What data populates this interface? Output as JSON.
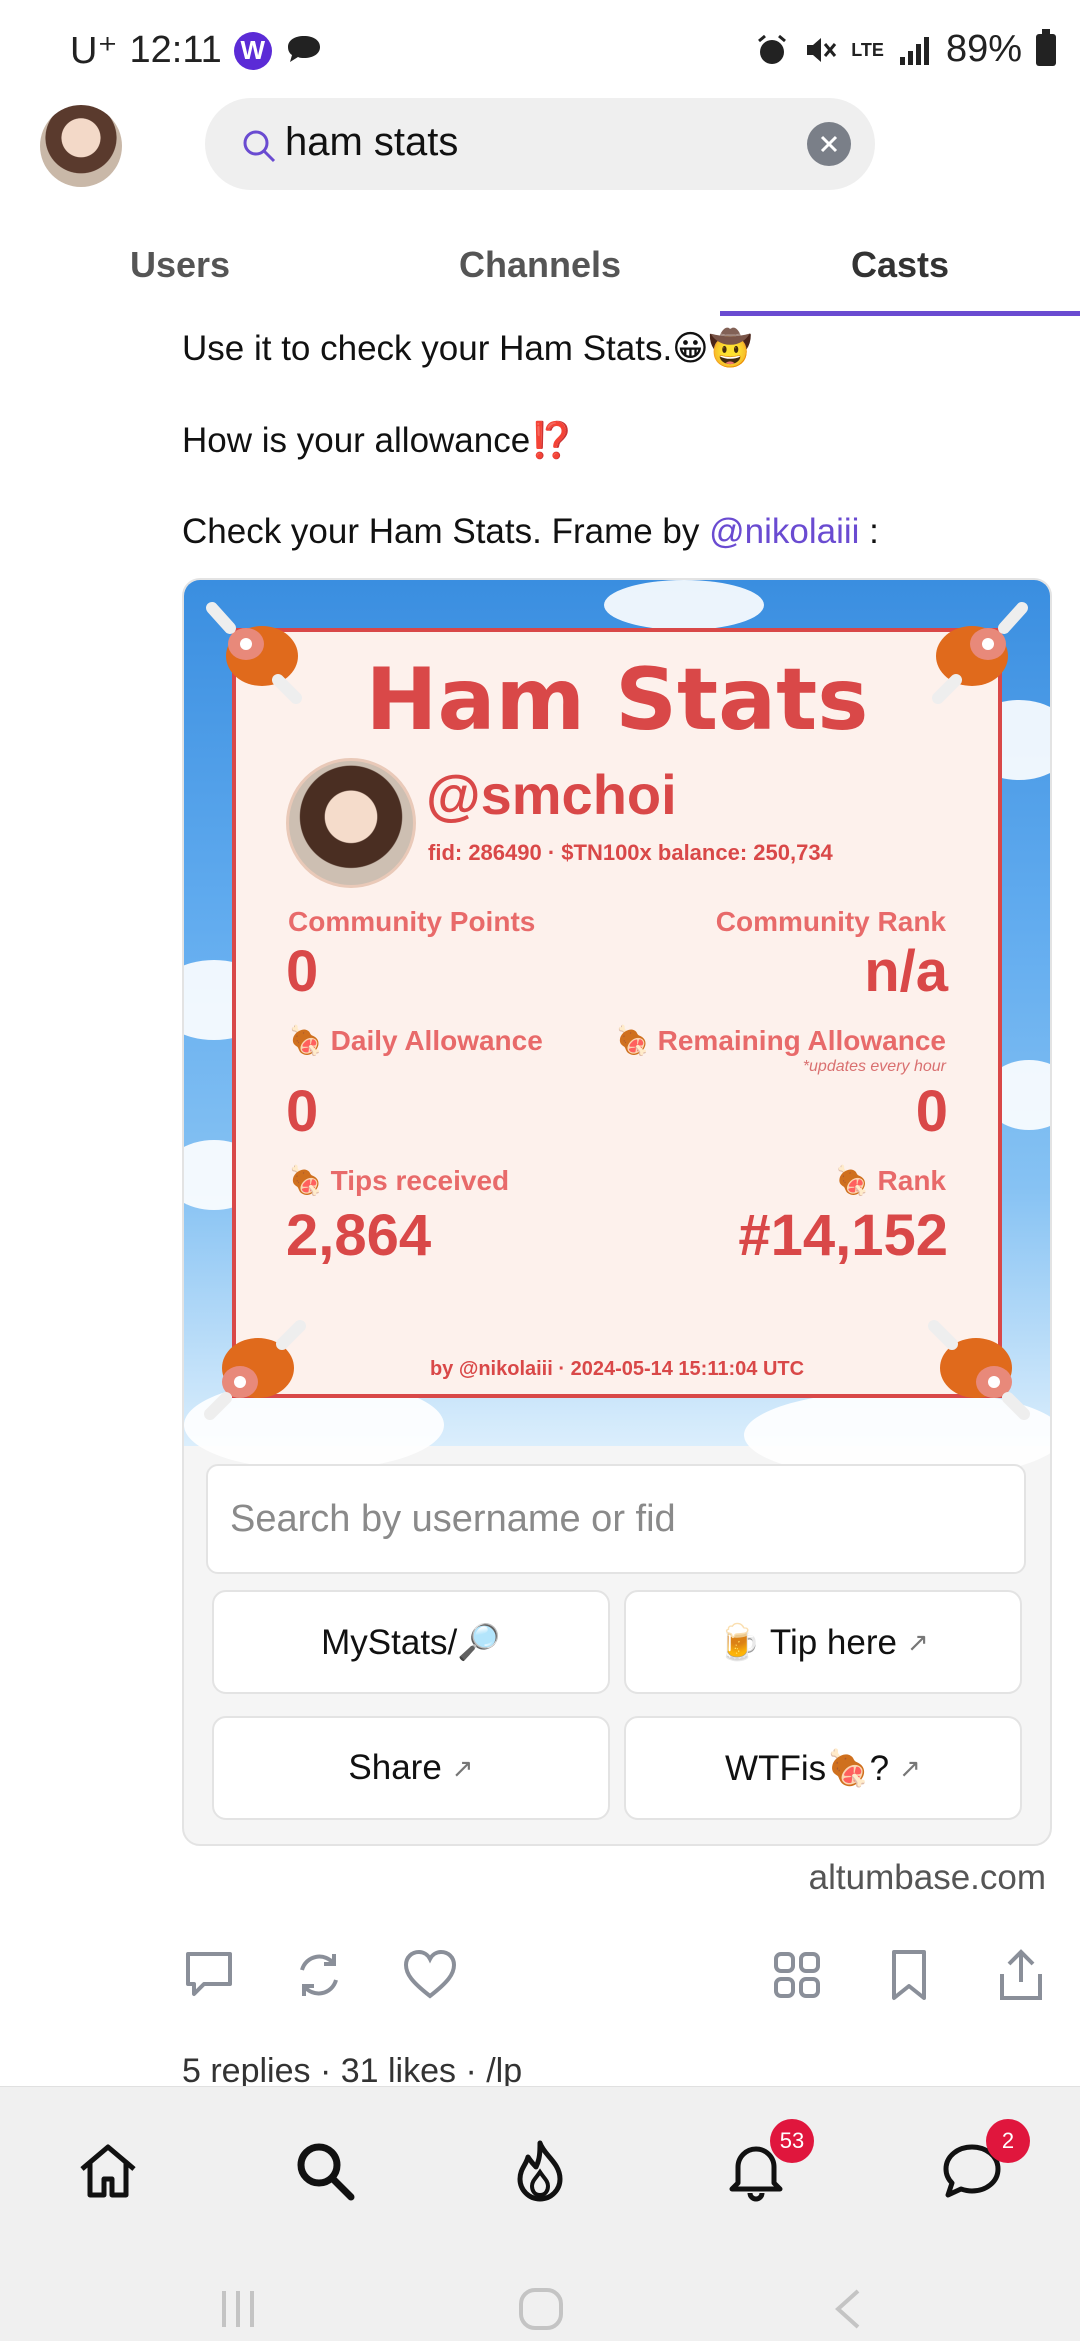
{
  "status_bar": {
    "carrier": "U⁺",
    "time": "12:11",
    "battery": "89%",
    "network": "LTE"
  },
  "search": {
    "query": "ham stats"
  },
  "tabs": [
    {
      "label": "Users"
    },
    {
      "label": "Channels"
    },
    {
      "label": "Casts"
    }
  ],
  "active_tab": "Casts",
  "cast": {
    "line1": "Use it to check your Ham Stats.😀🤠",
    "line2": "How is your allowance⁉️",
    "line3_prefix": "Check your Ham Stats. Frame by ",
    "line3_mention": "@nikolaiii",
    "line3_suffix": " :"
  },
  "frame": {
    "title": "Ham Stats",
    "handle": "@smchoi",
    "fid_line": "fid: 286490 · $TN100x balance: 250,734",
    "community_points_label": "Community Points",
    "community_points_value": "0",
    "community_rank_label": "Community Rank",
    "community_rank_value": "n/a",
    "daily_allowance_label": "Daily Allowance",
    "daily_allowance_value": "0",
    "remaining_allowance_label": "Remaining Allowance",
    "remaining_note": "*updates every hour",
    "remaining_allowance_value": "0",
    "tips_received_label": "Tips received",
    "tips_received_value": "2,864",
    "rank_label": "Rank",
    "rank_value": "#14,152",
    "credit": "by @nikolaiii · 2024-05-14 15:11:04 UTC",
    "input_placeholder": "Search by username or fid",
    "buttons": [
      {
        "label": "MyStats/🔎",
        "external": false
      },
      {
        "label": "🍺 Tip here",
        "external": true
      },
      {
        "label": "Share",
        "external": true
      },
      {
        "label": "WTFis🍖?",
        "external": true
      }
    ],
    "domain": "altumbase.com"
  },
  "stats_line": "5 replies · 31 likes · /lp",
  "nav": {
    "notifications_badge": "53",
    "messages_badge": "2"
  },
  "colors": {
    "accent": "#6a4bd1",
    "frame_red": "#d94848",
    "badge_red": "#e0163d"
  }
}
